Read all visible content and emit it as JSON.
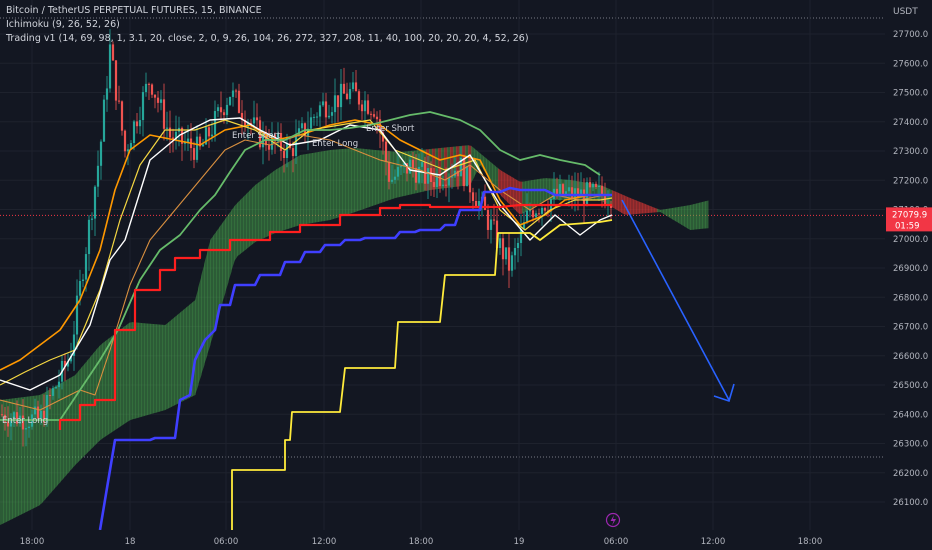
{
  "legend": {
    "symbol": "Bitcoin / TetherUS PERPETUAL FUTURES, 15, BINANCE",
    "indicator1": "Ichimoku (9, 26, 52, 26)",
    "indicator2": "Trading v1 (14, 69, 98, 1, 3.1, 20, close, 2, 0, 9, 26, 104, 26, 272, 327, 208, 11, 40, 100, 20, 20, 20, 4, 52, 26)"
  },
  "price_axis": {
    "currency": "USDT",
    "ticks": [
      "27700.0",
      "27600.0",
      "27500.0",
      "27400.0",
      "27300.0",
      "27200.0",
      "27100.0",
      "27000.0",
      "26900.0",
      "26800.0",
      "26700.0",
      "26600.0",
      "26500.0",
      "26400.0",
      "26300.0",
      "26200.0",
      "26100.0"
    ]
  },
  "time_axis": {
    "ticks": [
      "18:00",
      "18",
      "06:00",
      "12:00",
      "18:00",
      "19",
      "06:00",
      "12:00",
      "18:00"
    ]
  },
  "last_price": {
    "value": "27079.9",
    "countdown": "01:59",
    "color": "#f23645"
  },
  "labels": {
    "enter_long_1": "Enter Long",
    "enter_short_1": "Enter Short",
    "enter_long_2": "Enter Long",
    "enter_short_2": "Enter Short"
  },
  "colors": {
    "background": "#131722",
    "up_candle": "#26a69a",
    "down_candle": "#ef5350",
    "cloud_bull": "#4caf50",
    "cloud_bear": "#e53935",
    "yellow": "#ffeb3b",
    "blue": "#3f3fff",
    "red_line": "#ff1f1f",
    "green_line": "#66bb6a",
    "orange": "#ff9800",
    "white": "#ffffff",
    "arrow": "#2962ff"
  },
  "chart_data": {
    "type": "line",
    "y_axis_range": [
      26030,
      27800
    ],
    "x_range_hours": [
      "17 16:00",
      "20 00:00"
    ],
    "last_price": 27079.9,
    "series": [],
    "projection_arrow": {
      "from": [
        "19 07:00",
        27150
      ],
      "to": [
        "19 13:00",
        26440
      ]
    }
  },
  "footer": {
    "replay_icon": "lightning-icon"
  }
}
